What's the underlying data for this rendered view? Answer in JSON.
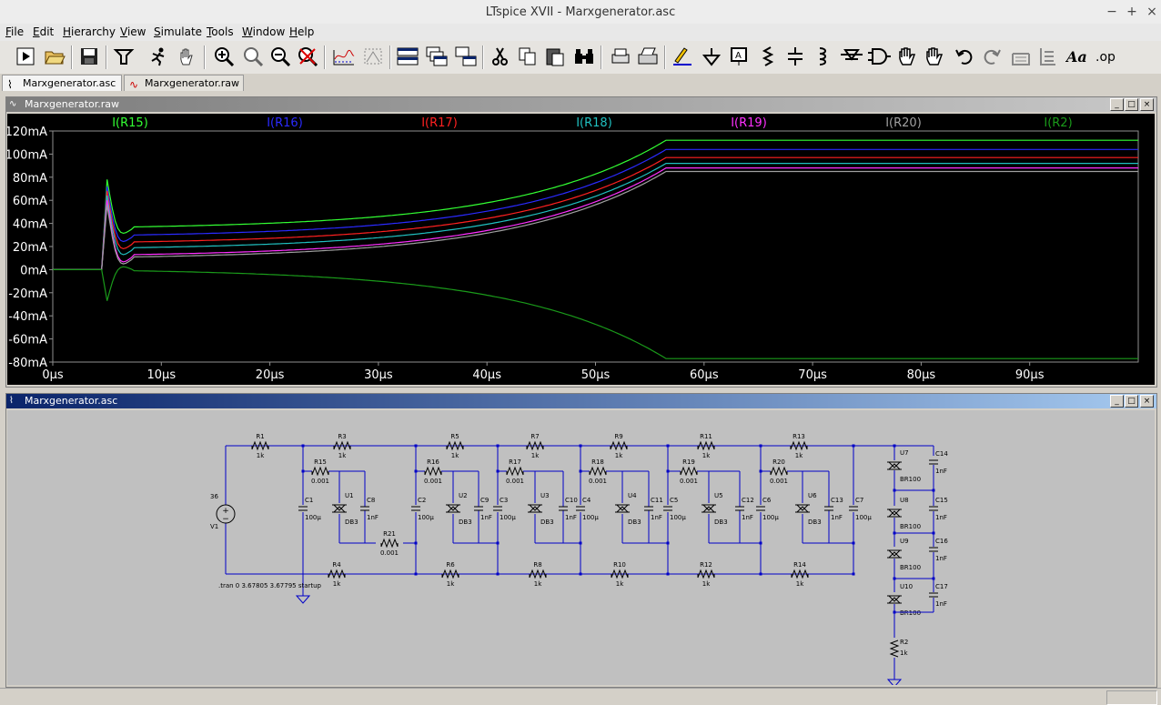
{
  "window": {
    "title": "LTspice XVII - Marxgenerator.asc"
  },
  "menu": [
    "File",
    "Edit",
    "Hierarchy",
    "View",
    "Simulate",
    "Tools",
    "Window",
    "Help"
  ],
  "menu_hotkeys": [
    "F",
    "E",
    "H",
    "V",
    "S",
    "T",
    "W",
    "H"
  ],
  "toolbar": [
    "run-icon",
    "open-icon",
    "save-icon",
    "control-panel-icon",
    "halt-icon",
    "pan-hand-icon",
    "zoom-in-icon",
    "zoom-area-icon",
    "zoom-out-icon",
    "zoom-cancel-icon",
    "autorange-icon",
    "pick-visible-icon",
    "tile-horizontal-icon",
    "cascade-icon",
    "tile-vertical-icon",
    "cut-icon",
    "copy-icon",
    "paste-icon",
    "find-icon",
    "print-preview-icon",
    "print-icon",
    "draw-wire-icon",
    "ground-icon",
    "label-net-icon",
    "resistor-icon",
    "capacitor-icon",
    "inductor-icon",
    "diode-icon",
    "component-icon",
    "move-icon",
    "drag-icon",
    "undo-icon",
    "redo-icon",
    "rotate-icon",
    "mirror-icon",
    "text-icon",
    "spice-directive-icon"
  ],
  "tabs": [
    {
      "label": "Marxgenerator.asc",
      "active": true
    },
    {
      "label": "Marxgenerator.raw",
      "active": false
    }
  ],
  "plot_window": {
    "title": "Marxgenerator.raw"
  },
  "schematic_window": {
    "title": "Marxgenerator.asc"
  },
  "chart_data": {
    "type": "line",
    "xlim": [
      0,
      100
    ],
    "ylim": [
      -80,
      120
    ],
    "x_ticks": [
      "0µs",
      "10µs",
      "20µs",
      "30µs",
      "40µs",
      "50µs",
      "60µs",
      "70µs",
      "80µs",
      "90µs"
    ],
    "y_ticks": [
      "120mA",
      "100mA",
      "80mA",
      "60mA",
      "40mA",
      "20mA",
      "0mA",
      "-20mA",
      "-40mA",
      "-60mA",
      "-80mA"
    ],
    "grid": false,
    "legend_placement": "top",
    "series": [
      {
        "name": "I(R15)",
        "color": "#33ff33",
        "spike": 78,
        "plateau": 37,
        "final": 112
      },
      {
        "name": "I(R16)",
        "color": "#2a2aff",
        "spike": 72,
        "plateau": 30,
        "final": 104
      },
      {
        "name": "I(R17)",
        "color": "#ff2020",
        "spike": 68,
        "plateau": 24,
        "final": 97
      },
      {
        "name": "I(R18)",
        "color": "#20c0c0",
        "spike": 64,
        "plateau": 19,
        "final": 92
      },
      {
        "name": "I(R19)",
        "color": "#ff30ff",
        "spike": 60,
        "plateau": 13,
        "final": 88
      },
      {
        "name": "I(R20)",
        "color": "#a0a0a0",
        "spike": 56,
        "plateau": 11,
        "final": 85
      },
      {
        "name": "I(R2)",
        "color": "#1a9a1a",
        "spike": -27,
        "plateau": -1,
        "final": -77
      }
    ]
  },
  "schematic": {
    "source": {
      "name": "V1",
      "value": "36"
    },
    "directive": ".tran 0 3.67805 3.67795 startup",
    "top_resistors": [
      {
        "name": "R1",
        "value": "1k"
      },
      {
        "name": "R3",
        "value": "1k"
      },
      {
        "name": "R5",
        "value": "1k"
      },
      {
        "name": "R7",
        "value": "1k"
      },
      {
        "name": "R9",
        "value": "1k"
      },
      {
        "name": "R11",
        "value": "1k"
      },
      {
        "name": "R13",
        "value": "1k"
      }
    ],
    "bottom_resistors": [
      {
        "name": "R4",
        "value": "1k"
      },
      {
        "name": "R6",
        "value": "1k"
      },
      {
        "name": "R8",
        "value": "1k"
      },
      {
        "name": "R10",
        "value": "1k"
      },
      {
        "name": "R12",
        "value": "1k"
      },
      {
        "name": "R14",
        "value": "1k"
      }
    ],
    "sense_resistors": [
      {
        "name": "R15",
        "value": "0.001"
      },
      {
        "name": "R16",
        "value": "0.001"
      },
      {
        "name": "R17",
        "value": "0.001"
      },
      {
        "name": "R18",
        "value": "0.001"
      },
      {
        "name": "R19",
        "value": "0.001"
      },
      {
        "name": "R20",
        "value": "0.001"
      }
    ],
    "r21": {
      "name": "R21",
      "value": "0.001"
    },
    "stage_caps": [
      {
        "name": "C1",
        "value": "100µ"
      },
      {
        "name": "C2",
        "value": "100µ"
      },
      {
        "name": "C3",
        "value": "100µ"
      },
      {
        "name": "C4",
        "value": "100µ"
      },
      {
        "name": "C5",
        "value": "100µ"
      },
      {
        "name": "C6",
        "value": "100µ"
      },
      {
        "name": "C7",
        "value": "100µ"
      }
    ],
    "diacs": [
      {
        "name": "U1",
        "value": "DB3"
      },
      {
        "name": "U2",
        "value": "DB3"
      },
      {
        "name": "U3",
        "value": "DB3"
      },
      {
        "name": "U4",
        "value": "DB3"
      },
      {
        "name": "U5",
        "value": "DB3"
      },
      {
        "name": "U6",
        "value": "DB3"
      }
    ],
    "diac_caps": [
      {
        "name": "C8",
        "value": "1nF"
      },
      {
        "name": "C9",
        "value": "1nF"
      },
      {
        "name": "C10",
        "value": "1nF"
      },
      {
        "name": "C11",
        "value": "1nF"
      },
      {
        "name": "C12",
        "value": "1nF"
      },
      {
        "name": "C13",
        "value": "1nF"
      }
    ],
    "breakovers": [
      {
        "name": "U7",
        "value": "BR100"
      },
      {
        "name": "U8",
        "value": "BR100"
      },
      {
        "name": "U9",
        "value": "BR100"
      },
      {
        "name": "U10",
        "value": "BR100"
      }
    ],
    "stack_caps": [
      {
        "name": "C14",
        "value": "1nF"
      },
      {
        "name": "C15",
        "value": "1nF"
      },
      {
        "name": "C16",
        "value": "1nF"
      },
      {
        "name": "C17",
        "value": "1nF"
      }
    ],
    "load": {
      "name": "R2",
      "value": "1k"
    }
  }
}
